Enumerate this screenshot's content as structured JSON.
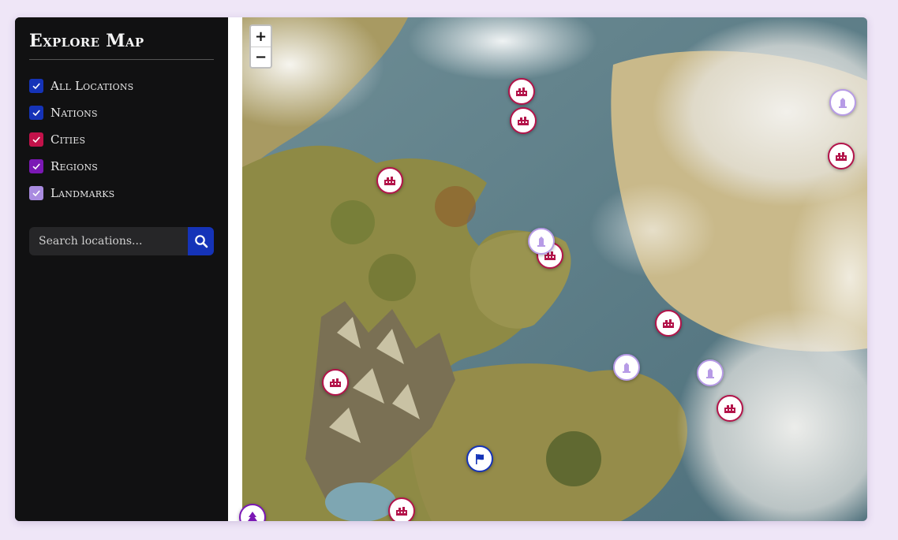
{
  "sidebar": {
    "title": "Explore Map",
    "filters": [
      {
        "label": "All Locations",
        "checked": true,
        "color": "#1533b8"
      },
      {
        "label": "Nations",
        "checked": true,
        "color": "#1533b8"
      },
      {
        "label": "Cities",
        "checked": true,
        "color": "#c2124a"
      },
      {
        "label": "Regions",
        "checked": true,
        "color": "#7b18b5"
      },
      {
        "label": "Landmarks",
        "checked": true,
        "color": "#a98be0"
      }
    ],
    "search": {
      "placeholder": "Search locations...",
      "value": ""
    },
    "search_button_icon": "search-icon"
  },
  "map": {
    "zoom_in_label": "+",
    "zoom_out_label": "−",
    "colors": {
      "city": "#b3144a",
      "landmark": "#b79be6",
      "nation": "#1533b8",
      "region": "#7b18b5",
      "sea": "#5c7f8a",
      "land": "#8e8a45"
    }
  }
}
